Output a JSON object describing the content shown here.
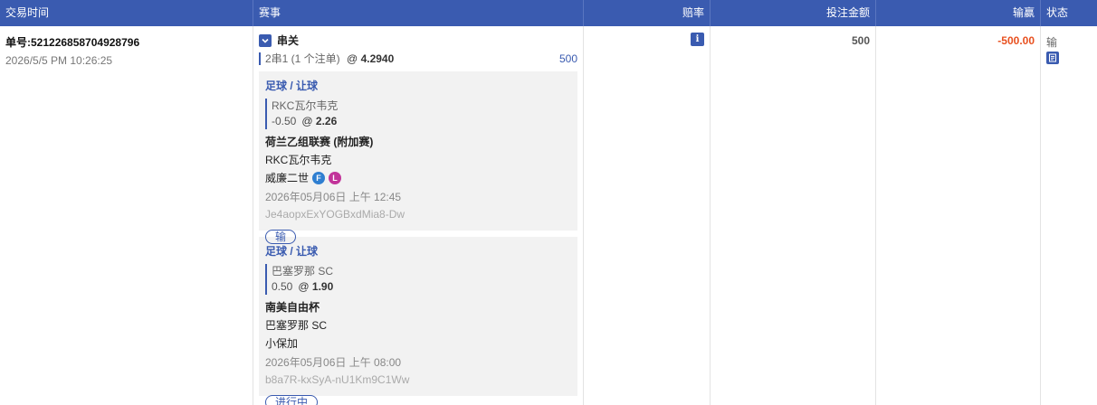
{
  "columns": {
    "time": "交易时间",
    "event": "赛事",
    "odds": "赔率",
    "stake": "投注金额",
    "winloss": "输赢",
    "status": "状态"
  },
  "order": {
    "number": "单号:521226858704928796",
    "time": "2026/5/5 PM 10:26:25",
    "combo_title": "串关",
    "combo_desc": "2串1 (1 个注单)",
    "combo_at": "@",
    "combo_odds": "4.2940",
    "combo_amount": "500",
    "stake": "500",
    "winloss": "-500.00",
    "status": "输",
    "colors": {
      "accent": "#3a5bb0",
      "loss": "#e8501f",
      "badge_f": "#2f7fd1",
      "badge_l": "#c2349a"
    }
  },
  "legs": [
    {
      "type": "足球 / 让球",
      "selection": "RKC瓦尔韦克",
      "handicap": "-0.50",
      "at": "@",
      "odds": "2.26",
      "league": "荷兰乙组联赛 (附加赛)",
      "home": "RKC瓦尔韦克",
      "away": "威廉二世",
      "badges": [
        "F",
        "L"
      ],
      "datetime": "2026年05月06日 上午 12:45",
      "id": "Je4aopxExYOGBxdMia8-Dw",
      "result": "输"
    },
    {
      "type": "足球 / 让球",
      "selection": "巴塞罗那 SC",
      "handicap": "0.50",
      "at": "@",
      "odds": "1.90",
      "league": "南美自由杯",
      "home": "巴塞罗那 SC",
      "away": "小保加",
      "datetime": "2026年05月06日 上午 08:00",
      "id": "b8a7R-kxSyA-nU1Km9C1Ww",
      "result": "进行中"
    }
  ],
  "icons": {
    "expand": "chevron-down-icon",
    "info": "info-icon",
    "doc": "document-icon"
  }
}
